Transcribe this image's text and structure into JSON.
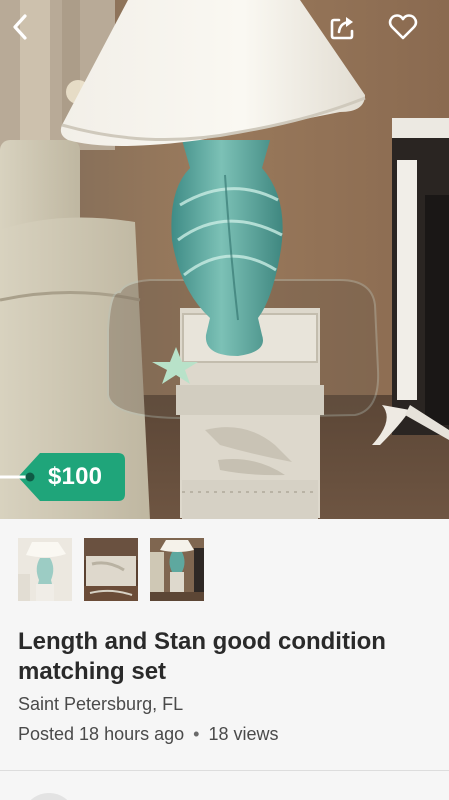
{
  "listing": {
    "price": "$100",
    "title": "Length and Stan good condition matching set",
    "location": "Saint Petersburg, FL",
    "posted": "Posted 18 hours ago",
    "views": "18 views",
    "separator": "•"
  },
  "photos": [
    {
      "name": "lamp-on-end-table"
    },
    {
      "name": "end-table-base-closeup"
    },
    {
      "name": "lamp-and-table-wide"
    }
  ],
  "toolbar": {
    "back_icon": "chevron-left-icon",
    "share_icon": "share-icon",
    "favorite_icon": "heart-outline-icon"
  },
  "colors": {
    "price_tag": "#1fa57a",
    "background": "#f6f6f6",
    "text": "#2a2a2a"
  }
}
